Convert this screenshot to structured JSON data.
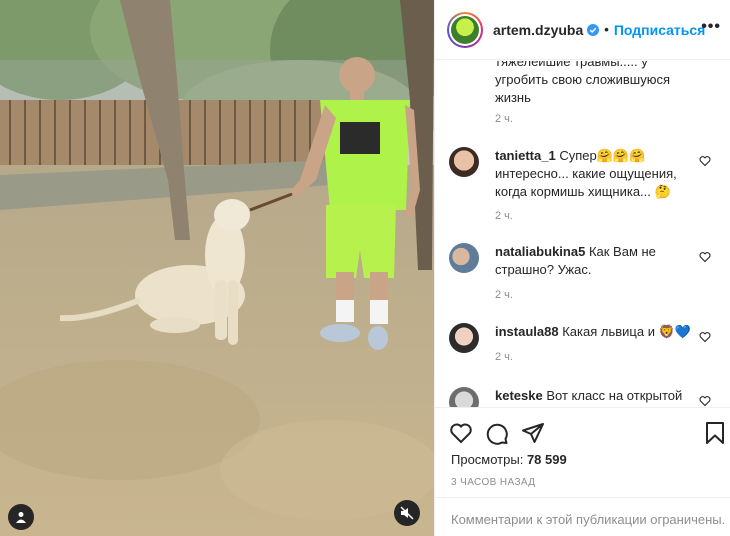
{
  "post": {
    "username": "artem.dzyuba",
    "follow_label": "Подписаться",
    "separator": "•",
    "more_label": "•••"
  },
  "comments": [
    {
      "username": "",
      "text": "тяжелейшие травмы..... у угробить свою сложившуюся жизнь",
      "time": "2 ч."
    },
    {
      "username": "tanietta_1",
      "text": "Супер🤗🤗🤗 интересно... какие ощущения, когда кормишь хищника... 🤔",
      "time": "2 ч."
    },
    {
      "username": "nataliabukina5",
      "text": "Как Вам не страшно? Ужас.",
      "time": "2 ч."
    },
    {
      "username": "instaula88",
      "text": "Какая львица и 🦁💙",
      "time": "2 ч."
    },
    {
      "username": "keteske",
      "text": "Вот класс на открытой",
      "time": ""
    }
  ],
  "stats": {
    "views_label": "Просмотры:",
    "views_value": "78 599",
    "time_ago": "3 часов назад"
  },
  "footer": {
    "comments_limited": "Комментарии к этой публикации ограничены."
  },
  "icons": {
    "verified": "verified-badge-icon",
    "like": "heart-icon",
    "comment": "comment-icon",
    "share": "share-icon",
    "save": "bookmark-icon",
    "tag": "user-tag-icon",
    "mute": "muted-speaker-icon"
  },
  "colors": {
    "link_blue": "#0095f6",
    "verified_blue": "#3897f0",
    "muted_text": "#8e8e8e",
    "text": "#262626",
    "border": "#efefef"
  }
}
